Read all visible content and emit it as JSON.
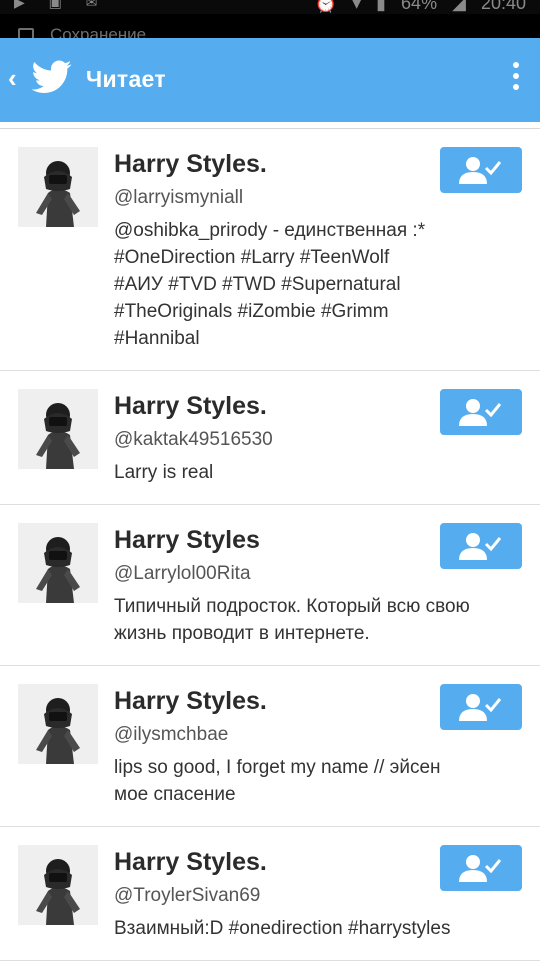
{
  "status_bar": {
    "battery": "64%",
    "time": "20:40"
  },
  "notification": {
    "text": "Сохранение"
  },
  "app_bar": {
    "title": "Читает"
  },
  "accounts": [
    {
      "name": "Harry Styles.",
      "handle": "@larryismyniall",
      "bio": "@oshibka_prirody - единственная :*\n#OneDirection #Larry #TeenWolf\n#АИУ #TVD #TWD #Supernatural\n#TheOriginals #iZombie #Grimm\n#Hannibal"
    },
    {
      "name": "Harry Styles.",
      "handle": "@kaktak49516530",
      "bio": "Larry is real"
    },
    {
      "name": "Harry Styles",
      "handle": "@Larrylol00Rita",
      "bio": "Типичный подросток. Который всю свою\nжизнь проводит в интернете."
    },
    {
      "name": "Harry Styles.",
      "handle": "@ilysmchbae",
      "bio": "lips so good, I forget my name // эйсен\nмое спасение"
    },
    {
      "name": "Harry Styles.",
      "handle": "@TroylerSivan69",
      "bio": "Взаимный:D #onedirection #harrystyles"
    }
  ],
  "colors": {
    "accent": "#55acee"
  }
}
